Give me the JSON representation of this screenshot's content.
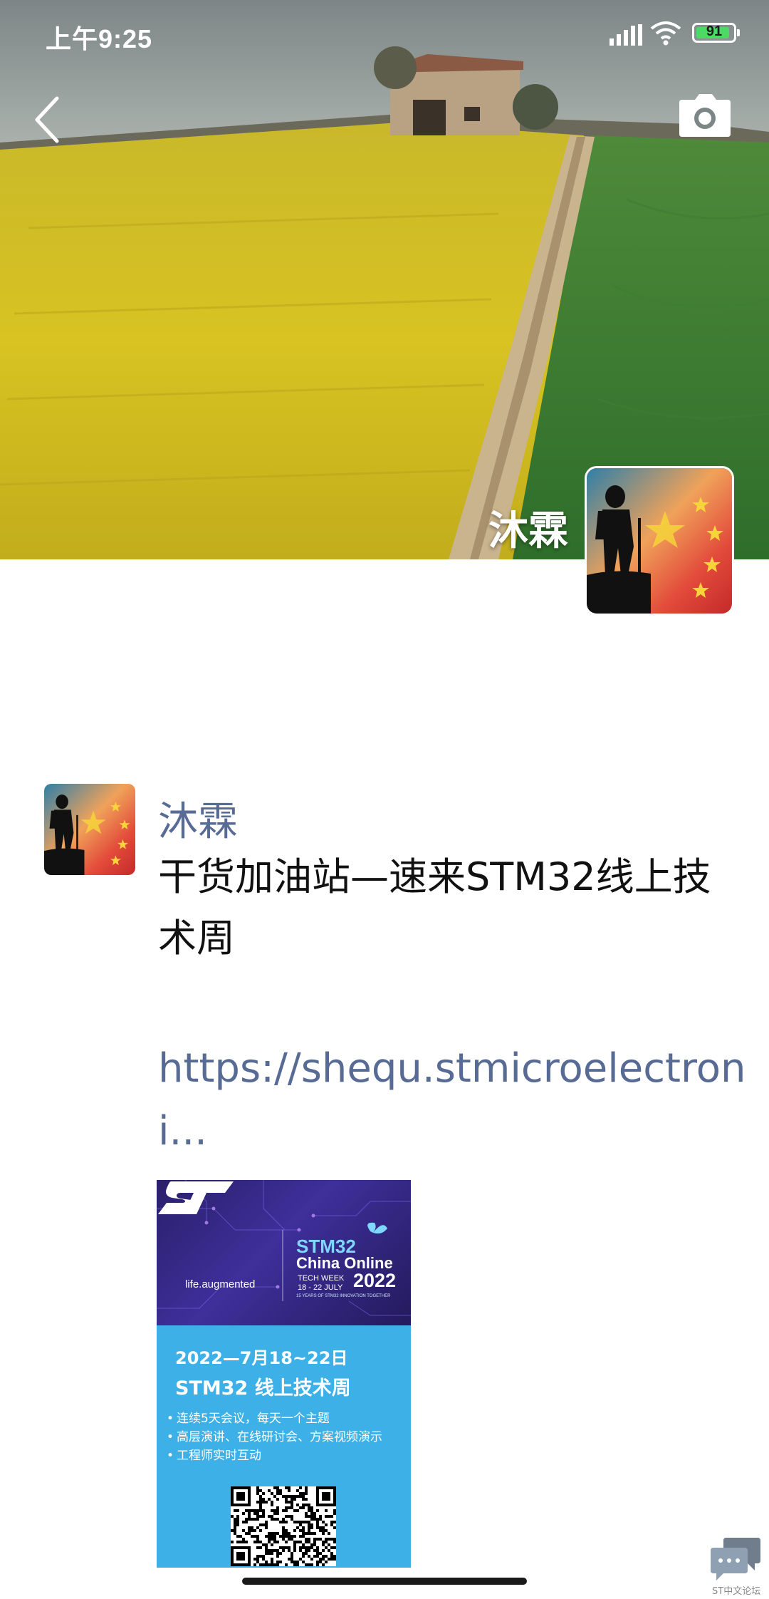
{
  "status_bar": {
    "time": "上午9:25",
    "battery_level": "91",
    "battery_fraction": 0.91,
    "icons": [
      "signal-icon",
      "wifi-icon",
      "battery-icon"
    ]
  },
  "nav": {
    "back_icon": "chevron-left-icon",
    "camera_icon": "camera-icon"
  },
  "profile": {
    "name": "沐霖"
  },
  "post": {
    "author": "沐霖",
    "text": "干货加油站—速来STM32线上技术周",
    "link": "https://shequ.stmicroelectroni..."
  },
  "poster": {
    "st_tagline": "life.augmented",
    "event_brand": "STM32",
    "event_name": "China Online",
    "event_week": "TECH WEEK",
    "event_dates_en": "18 - 22 JULY",
    "event_year": "2022",
    "event_sub": "15 YEARS OF STM32 INNOVATION TOGETHER",
    "date": "2022—7月18~22日",
    "title": "STM32 线上技术周",
    "bullets": [
      "连续5天会议，每天一个主题",
      "高层演讲、在线研讨会、方案视频演示",
      "工程师实时互动"
    ]
  },
  "watermark": {
    "label": "ST中文论坛"
  },
  "colors": {
    "link_blue": "#576b95",
    "poster_blue": "#3db0e8",
    "poster_purple": "#2a1f6a",
    "battery_green": "#4cd964"
  }
}
